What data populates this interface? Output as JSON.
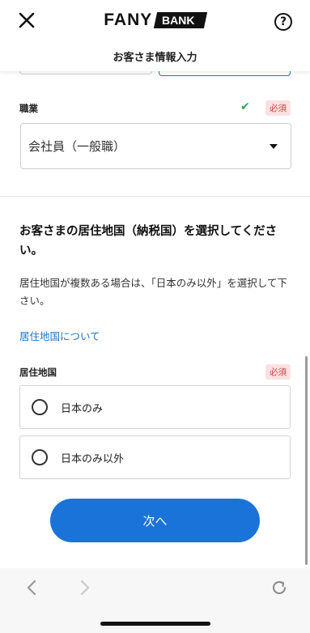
{
  "header": {
    "logo_main": "FANY",
    "logo_sub": "BANK",
    "help_label": "?"
  },
  "subheader": {
    "title": "お客さま情報入力"
  },
  "occupation": {
    "label": "職業",
    "required": "必須",
    "check": "✔",
    "value": "会社員（一般職）"
  },
  "residence": {
    "heading": "お客さまの居住地国（納税国）を選択してください。",
    "description": "居住地国が複数ある場合は、「日本のみ以外」を選択して下さい。",
    "link": "居住地国について",
    "label": "居住地国",
    "required": "必須",
    "options": [
      {
        "label": "日本のみ"
      },
      {
        "label": "日本のみ以外"
      }
    ]
  },
  "next_button": {
    "label": "次へ"
  },
  "colors": {
    "accent": "#1a73d9",
    "required_bg": "#fbe1e1",
    "required_text": "#d14343",
    "check": "#2aa64a",
    "link": "#1f73c9"
  }
}
